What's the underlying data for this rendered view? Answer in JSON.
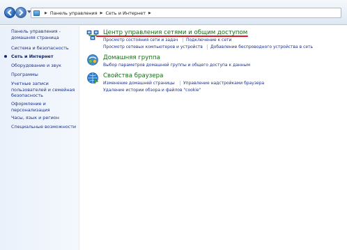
{
  "address_bar": {
    "breadcrumbs": [
      "Панель управления",
      "Сеть и Интернет"
    ]
  },
  "left_pane": {
    "items": [
      {
        "label": "Панель управления - домашняя страница"
      },
      {
        "label": "Система и безопасность"
      },
      {
        "label": "Сеть и Интернет"
      },
      {
        "label": "Оборудование и звук"
      },
      {
        "label": "Программы"
      },
      {
        "label": "Учетные записи пользователей и семейная безопасность"
      },
      {
        "label": "Оформление и персонализация"
      },
      {
        "label": "Часы, язык и регион"
      },
      {
        "label": "Специальные возможности"
      }
    ],
    "current_index": 2
  },
  "categories": [
    {
      "title": "Центр управления сетями и общим доступом",
      "icon": "network-center-icon",
      "links": [
        "Просмотр состояния сети и задач",
        "Подключение к сети",
        "Просмотр сетевых компьютеров и устройств",
        "Добавление беспроводного устройства в сеть"
      ]
    },
    {
      "title": "Домашняя группа",
      "icon": "homegroup-icon",
      "links": [
        "Выбор параметров домашней группы и общего доступа к данным"
      ]
    },
    {
      "title": "Свойства браузера",
      "icon": "internet-options-icon",
      "links": [
        "Изменение домашней страницы",
        "Управление надстройками браузера",
        "Удаление истории обзора и файлов \"cookie\""
      ]
    }
  ],
  "colors": {
    "category_title": "#196b1a",
    "link": "#1e3287",
    "annotation_underline": "#d9191f"
  }
}
